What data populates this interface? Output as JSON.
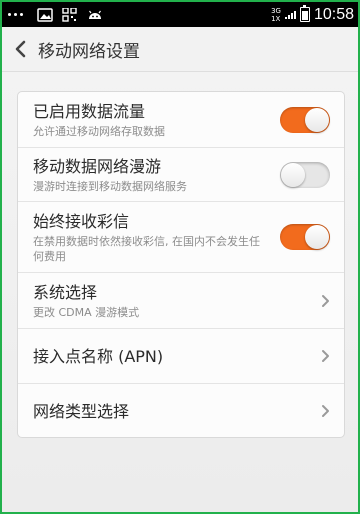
{
  "status_bar": {
    "net_top": "3G",
    "net_bottom": "1X",
    "time": "10:58"
  },
  "title_bar": {
    "title": "移动网络设置"
  },
  "settings": [
    {
      "title": "已启用数据流量",
      "subtitle": "允许通过移动网络存取数据",
      "control": "toggle",
      "checked": true
    },
    {
      "title": "移动数据网络漫游",
      "subtitle": "漫游时连接到移动数据网络服务",
      "control": "toggle",
      "checked": false
    },
    {
      "title": "始终接收彩信",
      "subtitle": "在禁用数据时依然接收彩信, 在国内不会发生任何费用",
      "control": "toggle",
      "checked": true
    },
    {
      "title": "系统选择",
      "subtitle": "更改 CDMA 漫游模式",
      "control": "chevron"
    },
    {
      "title": "接入点名称 (APN)",
      "control": "chevron"
    },
    {
      "title": "网络类型选择",
      "control": "chevron"
    }
  ],
  "colors": {
    "toggle_on": "#f26b1d",
    "toggle_off": "#e6e6e6"
  }
}
